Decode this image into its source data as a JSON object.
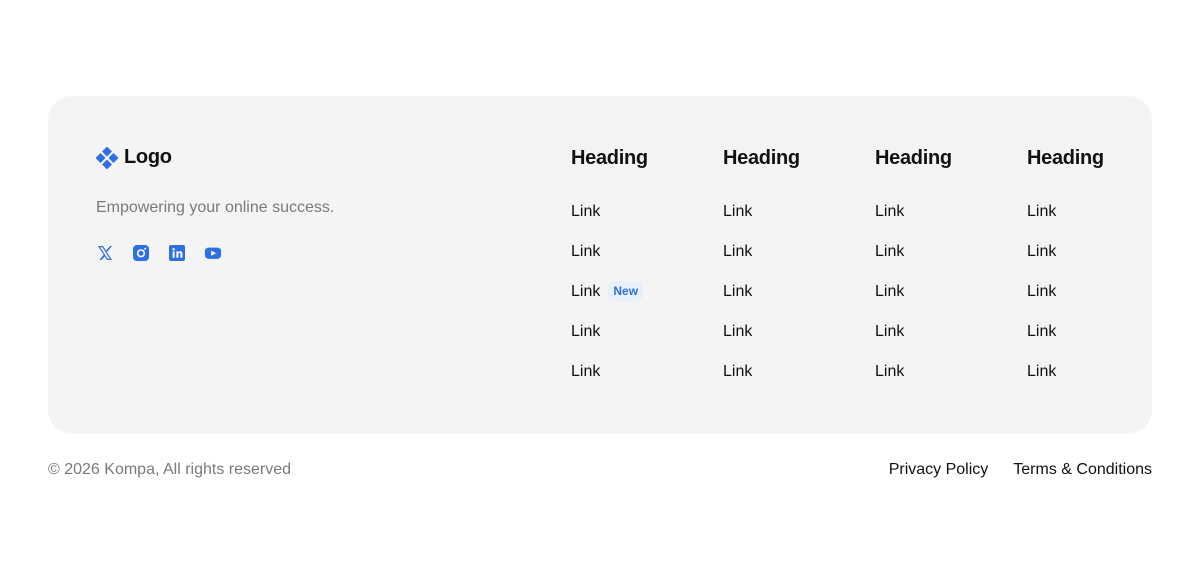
{
  "brand": {
    "name": "Logo",
    "icon": "diamond-logo-icon",
    "color": "#2f6fe4"
  },
  "tagline": "Empowering your online success.",
  "socials": [
    {
      "name": "x-icon"
    },
    {
      "name": "instagram-icon"
    },
    {
      "name": "linkedin-icon"
    },
    {
      "name": "youtube-icon"
    }
  ],
  "columns": [
    {
      "heading": "Heading",
      "links": [
        "Link",
        "Link",
        "Link",
        "Link",
        "Link"
      ],
      "badge": "New"
    },
    {
      "heading": "Heading",
      "links": [
        "Link",
        "Link",
        "Link",
        "Link",
        "Link"
      ]
    },
    {
      "heading": "Heading",
      "links": [
        "Link",
        "Link",
        "Link",
        "Link",
        "Link"
      ]
    },
    {
      "heading": "Heading",
      "links": [
        "Link",
        "Link",
        "Link",
        "Link",
        "Link"
      ]
    }
  ],
  "footer": {
    "copyright": "© 2026 Kompa, All rights reserved",
    "privacy": "Privacy Policy",
    "terms": "Terms & Conditions"
  }
}
